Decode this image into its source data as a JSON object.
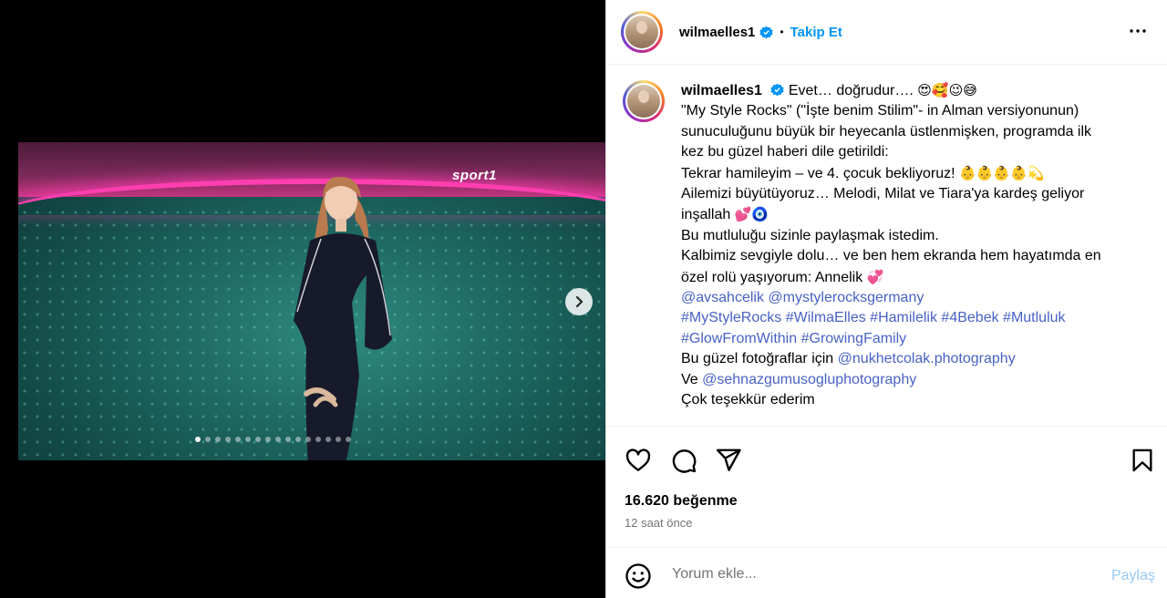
{
  "post": {
    "username": "wilmaelles1",
    "separator": "•",
    "follow_label": "Takip Et",
    "carousel": {
      "slide_count": 16,
      "active_index": 0,
      "watermark": "sport1"
    },
    "caption": {
      "line1_text": "Evet… doğrudur….",
      "line1_emojis": "😍🥰😉😅",
      "line2": "\"My Style Rocks\" (\"İşte benim Stilim\"- in Alman versiyonunun)",
      "line3": "sunuculuğunu büyük bir heyecanla üstlenmişken, programda ilk",
      "line4": "kez bu güzel haberi dile getirildi:",
      "line5_text": "Tekrar hamileyim – ve 4. çocuk bekliyoruz!",
      "line5_emojis": "👶👶👶👶💫",
      "line6": "Ailemizi büyütüyoruz… Melodi, Milat ve Tiara'ya kardeş geliyor",
      "line7_text": "inşallah",
      "line7_emojis": "💕🧿",
      "line8": "Bu mutluluğu sizinle paylaşmak istedim.",
      "line9": "Kalbimiz sevgiyle dolu… ve ben hem ekranda hem hayatımda en",
      "line10_text": "özel rolü yaşıyorum: Annelik",
      "line10_emojis": "💞",
      "mention1": "@avsahcelik",
      "mention2": "@mystylerocksgermany",
      "hashtags_line1": [
        "#MyStyleRocks",
        "#WilmaElles",
        "#Hamilelik",
        "#4Bebek",
        "#Mutluluk"
      ],
      "hashtags_line2": [
        "#GlowFromWithin",
        "#GrowingFamily"
      ],
      "photo_credit_prefix": "Bu güzel fotoğraflar için",
      "photo_credit_mention": "@nukhetcolak.photography",
      "and_prefix": "Ve",
      "and_mention": "@sehnazgumusogluphotography",
      "closing": "Çok teşekkür ederim"
    },
    "likes_text": "16.620 beğenme",
    "time_text": "12 saat önce",
    "comment": {
      "placeholder": "Yorum ekle...",
      "post_label": "Paylaş"
    }
  },
  "icons": {
    "verified": "verified-badge-icon",
    "more": "more-options-icon",
    "next": "chevron-right-icon",
    "like": "heart-icon",
    "comment": "comment-icon",
    "share": "share-icon",
    "save": "bookmark-icon",
    "emoji": "emoji-icon"
  },
  "colors": {
    "link": "#4862c4",
    "follow": "#0095f6",
    "post_disabled": "#99c9f5",
    "verified": "#0095f6"
  }
}
